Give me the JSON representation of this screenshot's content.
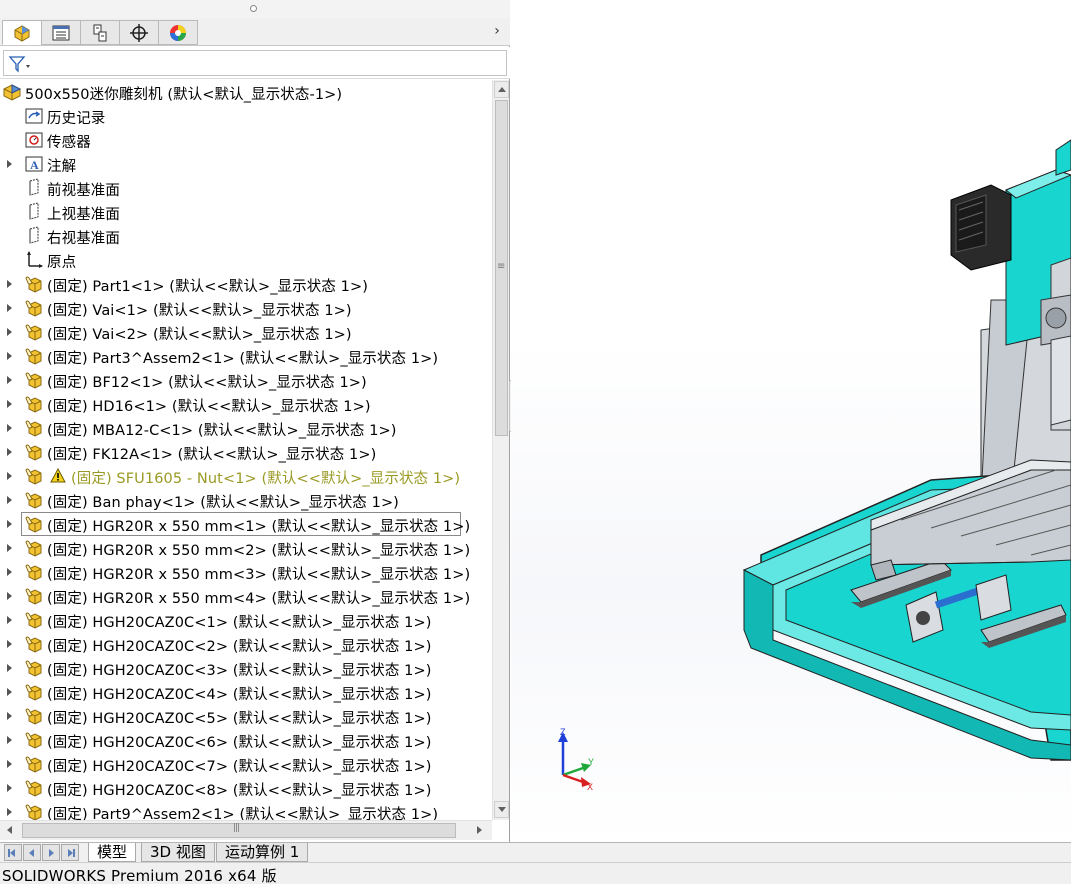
{
  "panel_tabs": [
    {
      "name": "featuremanager-tab-icon",
      "active": true
    },
    {
      "name": "propertymanager-tab-icon",
      "active": false
    },
    {
      "name": "configurationmanager-tab-icon",
      "active": false
    },
    {
      "name": "dimxpert-tab-icon",
      "active": false
    },
    {
      "name": "display-manager-tab-icon",
      "active": false
    }
  ],
  "tree": {
    "root_label": "500x550迷你雕刻机  (默认<默认_显示状态-1>)",
    "fixed_items": [
      {
        "label": "历史记录",
        "icon": "history-icon"
      },
      {
        "label": "传感器",
        "icon": "sensor-icon"
      },
      {
        "label": "注解",
        "icon": "annotation-icon",
        "expandable": true
      },
      {
        "label": "前视基准面",
        "icon": "plane-icon"
      },
      {
        "label": "上视基准面",
        "icon": "plane-icon"
      },
      {
        "label": "右视基准面",
        "icon": "plane-icon"
      },
      {
        "label": "原点",
        "icon": "origin-icon"
      }
    ],
    "components": [
      {
        "label": "(固定) Part1<1> (默认<<默认>_显示状态 1>)"
      },
      {
        "label": "(固定) Vai<1> (默认<<默认>_显示状态 1>)"
      },
      {
        "label": "(固定) Vai<2> (默认<<默认>_显示状态 1>)"
      },
      {
        "label": "(固定) Part3^Assem2<1> (默认<<默认>_显示状态 1>)"
      },
      {
        "label": "(固定) BF12<1> (默认<<默认>_显示状态 1>)"
      },
      {
        "label": "(固定) HD16<1> (默认<<默认>_显示状态 1>)"
      },
      {
        "label": "(固定) MBA12-C<1> (默认<<默认>_显示状态 1>)"
      },
      {
        "label": "(固定) FK12A<1> (默认<<默认>_显示状态 1>)"
      },
      {
        "label": "(固定) SFU1605 - Nut<1> (默认<<默认>_显示状态 1>)",
        "warning": true
      },
      {
        "label": "(固定) Ban phay<1> (默认<<默认>_显示状态 1>)"
      },
      {
        "label": "(固定) HGR20R x 550 mm<1> (默认<<默认>_显示状态 1>)",
        "selected": true
      },
      {
        "label": "(固定) HGR20R x 550 mm<2> (默认<<默认>_显示状态 1>)"
      },
      {
        "label": "(固定) HGR20R x 550 mm<3> (默认<<默认>_显示状态 1>)"
      },
      {
        "label": "(固定) HGR20R x 550 mm<4> (默认<<默认>_显示状态 1>)"
      },
      {
        "label": "(固定) HGH20CAZ0C<1> (默认<<默认>_显示状态 1>)"
      },
      {
        "label": "(固定) HGH20CAZ0C<2> (默认<<默认>_显示状态 1>)"
      },
      {
        "label": "(固定) HGH20CAZ0C<3> (默认<<默认>_显示状态 1>)"
      },
      {
        "label": "(固定) HGH20CAZ0C<4> (默认<<默认>_显示状态 1>)"
      },
      {
        "label": "(固定) HGH20CAZ0C<5> (默认<<默认>_显示状态 1>)"
      },
      {
        "label": "(固定) HGH20CAZ0C<6> (默认<<默认>_显示状态 1>)"
      },
      {
        "label": "(固定) HGH20CAZ0C<7> (默认<<默认>_显示状态 1>)"
      },
      {
        "label": "(固定) HGH20CAZ0C<8> (默认<<默认>_显示状态 1>)"
      },
      {
        "label": "(固定) Part9^Assem2<1> (默认<<默认>_显示状态 1>)"
      }
    ]
  },
  "triad": {
    "x": "X",
    "y": "Y",
    "z": "Z"
  },
  "bottom_tabs": [
    "模型",
    "3D 视图",
    "运动算例 1"
  ],
  "status": {
    "text": "SOLIDWORKS Premium 2016 x64 版"
  },
  "colors": {
    "model_cyan": "#19d5d0",
    "model_gray": "#d8d8d8",
    "warning_text": "#9a9a24"
  }
}
